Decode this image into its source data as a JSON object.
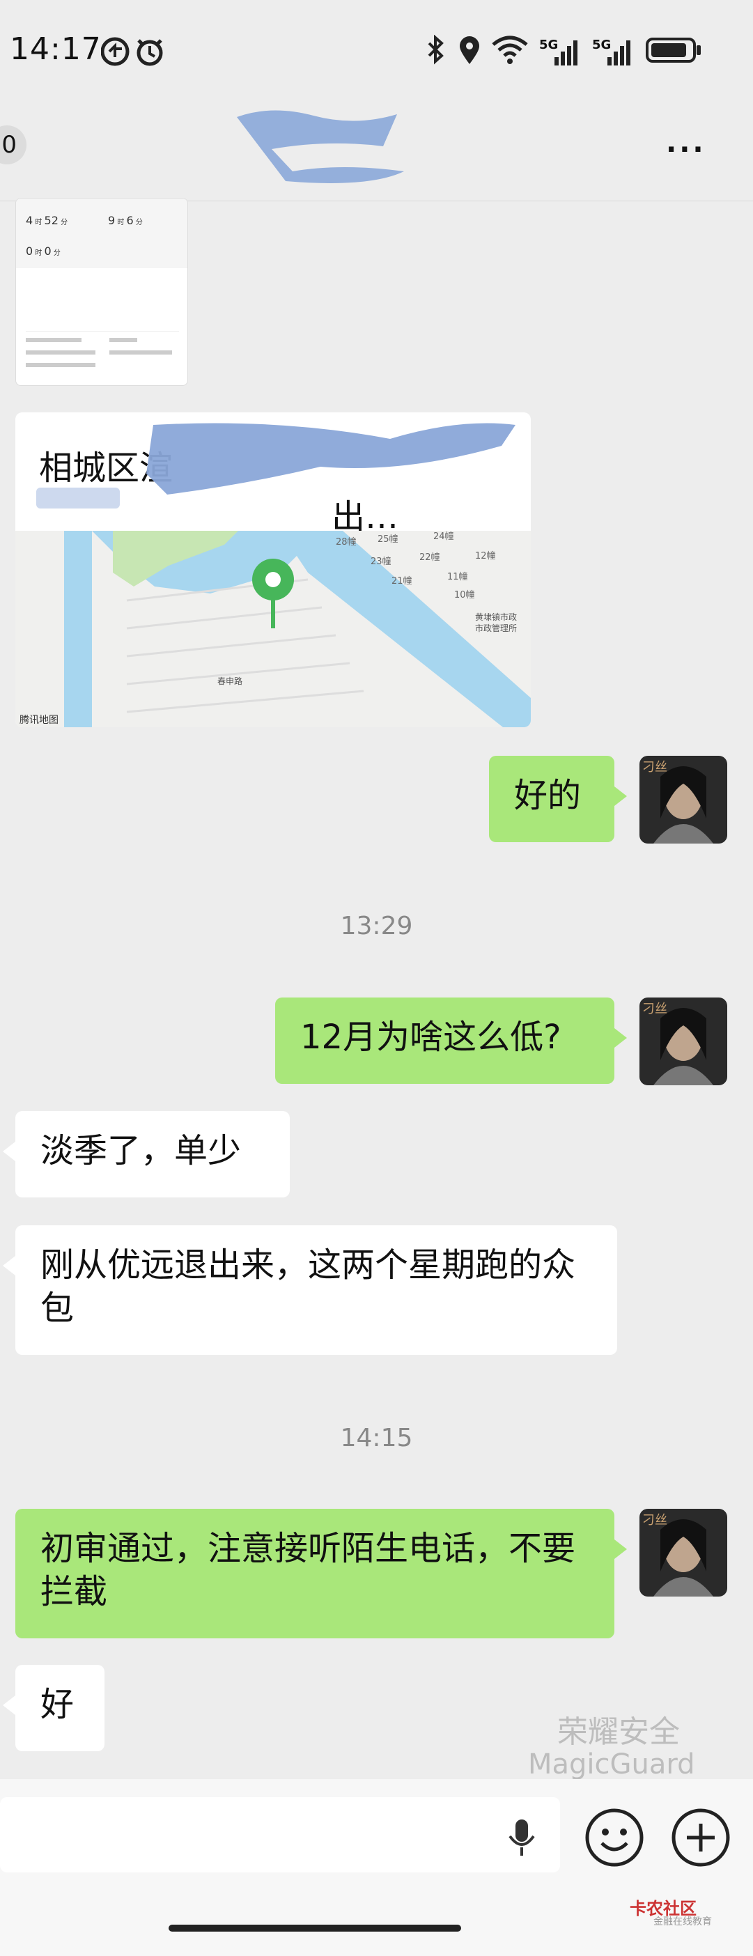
{
  "status": {
    "time": "14:17",
    "net1": "5G",
    "net2": "5G"
  },
  "header": {
    "unread_count": "0",
    "more": "···"
  },
  "location": {
    "title": "相城区渲",
    "title_suffix": "出…",
    "map_brand": "腾讯地图",
    "map_labels": [
      "28幢",
      "25幢",
      "24幢",
      "23幢",
      "22幢",
      "12幢",
      "11幢",
      "21幢",
      "10幢",
      "黄埭镇市政",
      "市政管理所",
      "春申路"
    ]
  },
  "messages": [
    {
      "side": "right",
      "text": "好的"
    },
    {
      "timestamp": "13:29"
    },
    {
      "side": "right",
      "text": "12月为啥这么低?"
    },
    {
      "side": "left",
      "text": "淡季了，单少"
    },
    {
      "side": "left",
      "text": "刚从优远退出来，这两个星期跑的众包"
    },
    {
      "timestamp": "14:15"
    },
    {
      "side": "right",
      "text": "初审通过，注意接听陌生电话，不要拦截"
    },
    {
      "side": "left",
      "text": "好"
    }
  ],
  "avatar_tag": "刁丝",
  "watermark": {
    "line1": "荣耀安全",
    "line2": "MagicGuard"
  },
  "corner": {
    "logo": "卡农社区",
    "sub": "金融在线教育"
  },
  "colors": {
    "bg": "#ededed",
    "self_bubble": "#a9e77a",
    "other_bubble": "#ffffff"
  },
  "icons": [
    "mic-icon",
    "emoji-icon",
    "plus-icon"
  ]
}
